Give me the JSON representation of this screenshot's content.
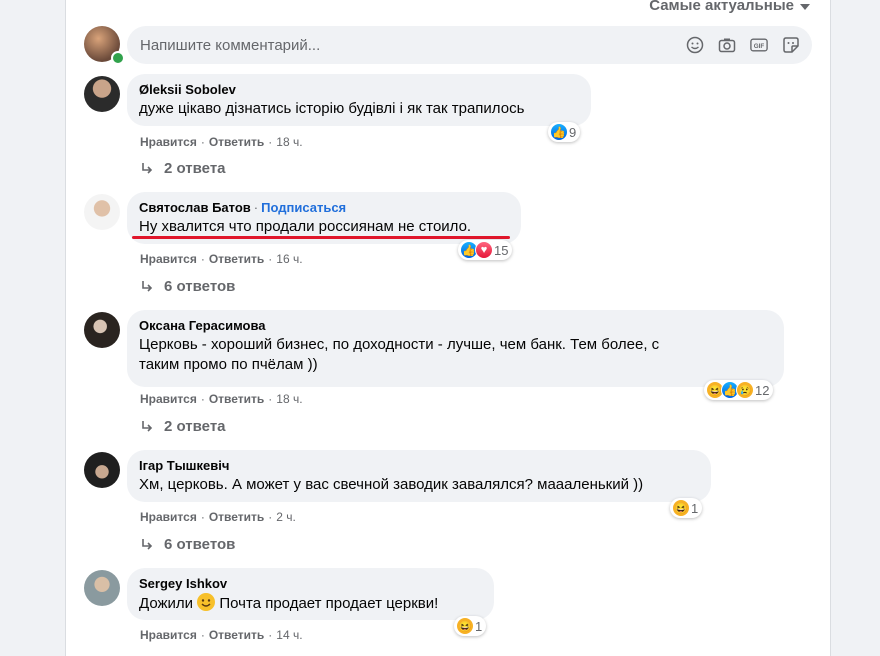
{
  "sort_label": "Самые актуальные",
  "composer": {
    "placeholder": "Напишите комментарий...",
    "icons": [
      "emoji-icon",
      "camera-icon",
      "gif-icon",
      "sticker-icon"
    ]
  },
  "colors": {
    "background": "#f0f2f5",
    "bubble": "#f0f2f5",
    "link": "#216fdb",
    "underline_annotation": "#e0162b",
    "online": "#31a24c"
  },
  "comments": [
    {
      "author": "Øleksii Sobolev",
      "text": "дуже цікаво дізнатись історію будівлі і як так трапилось",
      "like": "Нравится",
      "reply": "Ответить",
      "time": "18 ч.",
      "reactions": [
        "like"
      ],
      "reaction_count": "9",
      "replies": "2 ответа"
    },
    {
      "author": "Святослав Батов",
      "follow": "Подписаться",
      "text": "Ну хвалится что продали россиянам не стоило.",
      "like": "Нравится",
      "reply": "Ответить",
      "time": "16 ч.",
      "reactions": [
        "like",
        "love"
      ],
      "reaction_count": "15",
      "replies": "6 ответов"
    },
    {
      "author": "Оксана Герасимова",
      "text_line1": "Церковь - хороший бизнес, по доходности - лучше, чем банк. Тем более, с",
      "text_line2": "таким промо по пчёлам ))",
      "like": "Нравится",
      "reply": "Ответить",
      "time": "18 ч.",
      "reactions": [
        "haha",
        "like",
        "sad"
      ],
      "reaction_count": "12",
      "replies": "2 ответа"
    },
    {
      "author": "Ігар Тышкевіч",
      "text": "Хм, церковь. А может у вас свечной заводик завалялся? маааленький ))",
      "like": "Нравится",
      "reply": "Ответить",
      "time": "2 ч.",
      "reactions": [
        "haha"
      ],
      "reaction_count": "1",
      "replies": "6 ответов"
    },
    {
      "author": "Sergey Ishkov",
      "text_before": "Дожили",
      "text_after": "Почта продает продает церкви!",
      "like": "Нравится",
      "reply": "Ответить",
      "time": "14 ч.",
      "reactions": [
        "haha"
      ],
      "reaction_count": "1"
    }
  ]
}
